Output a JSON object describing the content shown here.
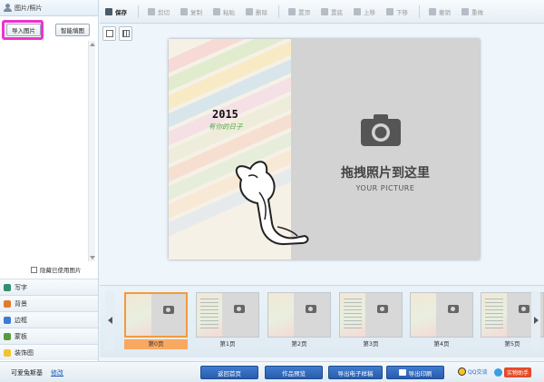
{
  "left_panel": {
    "header": "图片/照片",
    "import_button": "导入图片",
    "smart_fill_button": "智能填图",
    "hide_used_label": "隐藏已使用图片",
    "categories": [
      {
        "label": "写字",
        "icon": "text-T-icon",
        "color": "#2f8f6e"
      },
      {
        "label": "背景",
        "icon": "background-icon",
        "color": "#e27a2a"
      },
      {
        "label": "边框",
        "icon": "border-icon",
        "color": "#3a7bd5"
      },
      {
        "label": "蒙板",
        "icon": "mask-icon",
        "color": "#5a9a3a"
      },
      {
        "label": "装饰图",
        "icon": "star-icon",
        "color": "#f2c230"
      }
    ]
  },
  "toolbar": {
    "items": [
      {
        "label": "保存",
        "icon": "save-icon",
        "enabled": true
      },
      {
        "label": "剪切",
        "icon": "cut-icon",
        "enabled": false
      },
      {
        "label": "复制",
        "icon": "copy-icon",
        "enabled": false
      },
      {
        "label": "粘贴",
        "icon": "paste-icon",
        "enabled": false
      },
      {
        "label": "删除",
        "icon": "delete-icon",
        "enabled": false
      },
      {
        "label": "置顶",
        "icon": "bring-top-icon",
        "enabled": false
      },
      {
        "label": "置底",
        "icon": "send-bottom-icon",
        "enabled": false
      },
      {
        "label": "上移",
        "icon": "move-up-icon",
        "enabled": false
      },
      {
        "label": "下移",
        "icon": "move-down-icon",
        "enabled": false
      },
      {
        "label": "撤销",
        "icon": "undo-icon",
        "enabled": false
      },
      {
        "label": "重做",
        "icon": "redo-icon",
        "enabled": false
      }
    ]
  },
  "canvas": {
    "year": "2015",
    "script_text": "有你的日子",
    "placeholder_main": "拖拽照片到这里",
    "placeholder_sub": "YOUR PICTURE"
  },
  "filmstrip": {
    "pages": [
      "第0页",
      "第1页",
      "第2页",
      "第3页",
      "第4页",
      "第5页"
    ],
    "selected_index": 0
  },
  "bottom": {
    "project_name": "可爱兔斯基",
    "rename_link": "修改",
    "buttons": [
      "返回首页",
      "作品预览",
      "导出电子样稿",
      "导出印刷"
    ],
    "qq_label": "QQ交谈",
    "xm_label": "实物助手"
  },
  "colors": {
    "highlight": "#ee33cc",
    "selected_page": "#f9a862",
    "primary_button": "#2f67bd"
  }
}
